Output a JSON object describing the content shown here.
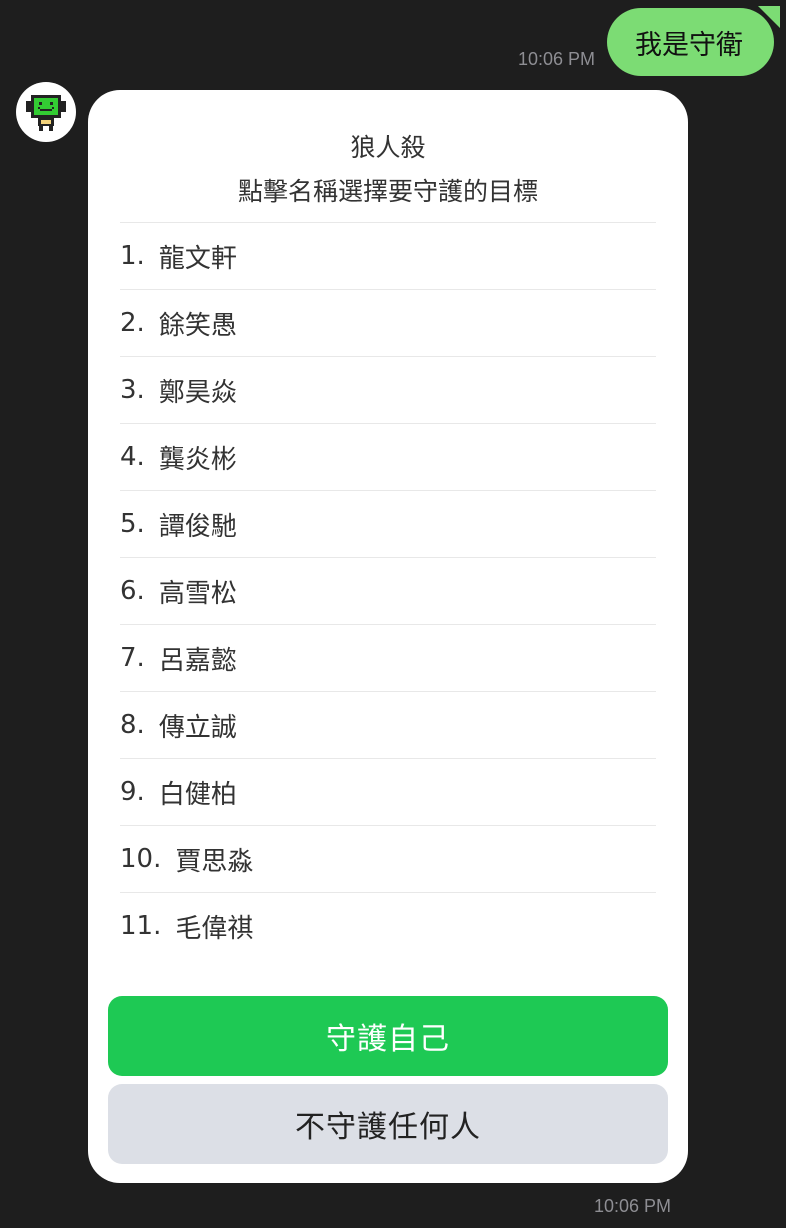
{
  "outgoing_message": {
    "text": "我是守衛",
    "time": "10:06 PM"
  },
  "incoming_card": {
    "title": "狼人殺",
    "subtitle": "點擊名稱選擇要守護的目標",
    "players": [
      {
        "num": "1.",
        "name": "龍文軒"
      },
      {
        "num": "2.",
        "name": "餘笑愚"
      },
      {
        "num": "3.",
        "name": "鄭昊焱"
      },
      {
        "num": "4.",
        "name": "龔炎彬"
      },
      {
        "num": "5.",
        "name": "譚俊馳"
      },
      {
        "num": "6.",
        "name": "高雪松"
      },
      {
        "num": "7.",
        "name": "呂嘉懿"
      },
      {
        "num": "8.",
        "name": "傳立誠"
      },
      {
        "num": "9.",
        "name": "白健柏"
      },
      {
        "num": "10.",
        "name": "賈思淼"
      },
      {
        "num": "11.",
        "name": "毛偉祺"
      }
    ],
    "protect_self_label": "守護自己",
    "protect_none_label": "不守護任何人",
    "time": "10:06 PM"
  },
  "colors": {
    "background": "#1e1e1e",
    "outgoing_bubble": "#7cdc74",
    "primary_button": "#1ec954",
    "secondary_button": "#dcdfe6",
    "bot_screen": "#33cc33"
  },
  "icons": {
    "bot_avatar": "robot-avatar-icon"
  }
}
